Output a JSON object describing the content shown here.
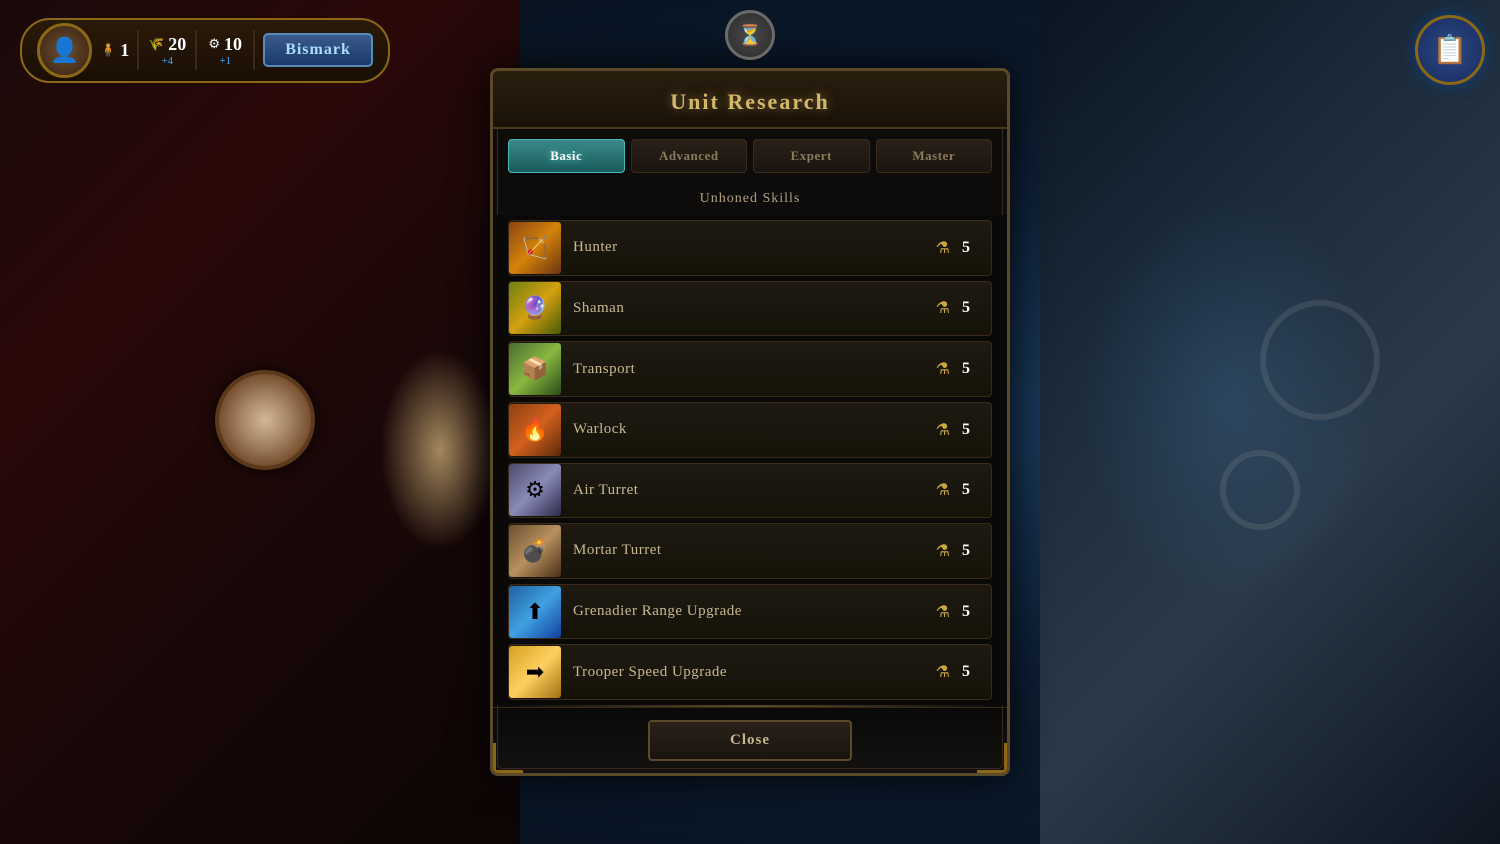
{
  "background": {
    "left_color": "#2a0808",
    "right_color": "#1a2a3a"
  },
  "header": {
    "player_name": "Bismark",
    "resources": {
      "food_current": "20",
      "food_delta": "+4",
      "gold_current": "10",
      "gold_delta": "+1",
      "pop_current": "1"
    },
    "top_right_icon": "📋"
  },
  "dialog": {
    "title": "Unit Research",
    "title_icon": "⏳",
    "tabs": [
      {
        "id": "basic",
        "label": "Basic",
        "active": true
      },
      {
        "id": "advanced",
        "label": "Advanced",
        "active": false
      },
      {
        "id": "expert",
        "label": "Expert",
        "active": false
      },
      {
        "id": "master",
        "label": "Master",
        "active": false
      }
    ],
    "section_label": "Unhoned Skills",
    "skills": [
      {
        "id": "hunter",
        "name": "Hunter",
        "icon": "🏹",
        "icon_class": "hunter",
        "cost": 5
      },
      {
        "id": "shaman",
        "name": "Shaman",
        "icon": "🔮",
        "icon_class": "shaman",
        "cost": 5
      },
      {
        "id": "transport",
        "name": "Transport",
        "icon": "📦",
        "icon_class": "transport",
        "cost": 5
      },
      {
        "id": "warlock",
        "name": "Warlock",
        "icon": "🔥",
        "icon_class": "warlock",
        "cost": 5
      },
      {
        "id": "airturret",
        "name": "Air Turret",
        "icon": "⚙",
        "icon_class": "airturret",
        "cost": 5
      },
      {
        "id": "mortarturret",
        "name": "Mortar Turret",
        "icon": "💣",
        "icon_class": "mortarturret",
        "cost": 5
      },
      {
        "id": "grenadier",
        "name": "Grenadier Range Upgrade",
        "icon": "⬆",
        "icon_class": "grenadier",
        "cost": 5
      },
      {
        "id": "trooper",
        "name": "Trooper Speed Upgrade",
        "icon": "➡",
        "icon_class": "trooper",
        "cost": 5
      }
    ],
    "close_button": "Close",
    "cost_icon": "⚗"
  }
}
